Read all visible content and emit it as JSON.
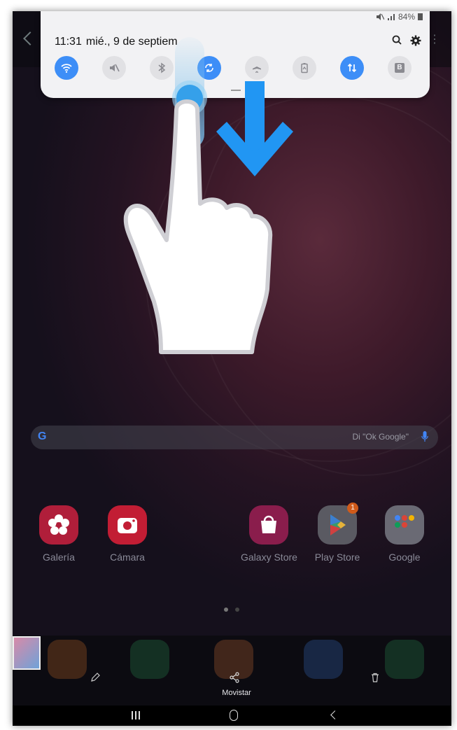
{
  "status_bar": {
    "battery": "84%"
  },
  "quick_panel": {
    "time": "11:31",
    "date": "mié., 9 de septiem",
    "toggles": [
      {
        "name": "wifi",
        "state": "on"
      },
      {
        "name": "sound-muted",
        "state": "off"
      },
      {
        "name": "bluetooth",
        "state": "off"
      },
      {
        "name": "auto-rotate",
        "state": "on"
      },
      {
        "name": "airplane-mode",
        "state": "off"
      },
      {
        "name": "power-saving",
        "state": "off"
      },
      {
        "name": "mobile-data",
        "state": "on"
      },
      {
        "name": "b-label",
        "state": "off",
        "label": "B"
      }
    ]
  },
  "search": {
    "placeholder": "Di \"Ok Google\"",
    "logo": "G"
  },
  "apps": [
    {
      "label": "Galería"
    },
    {
      "label": "Cámara"
    },
    {
      "label": "Galaxy Store"
    },
    {
      "label": "Play Store",
      "badge": "1"
    },
    {
      "label": "Google"
    }
  ],
  "dock": {
    "label": "Movistar"
  },
  "colors": {
    "accent": "#3d8ef7",
    "arrow": "#2196f3",
    "panel_bg": "#f2f2f4"
  }
}
